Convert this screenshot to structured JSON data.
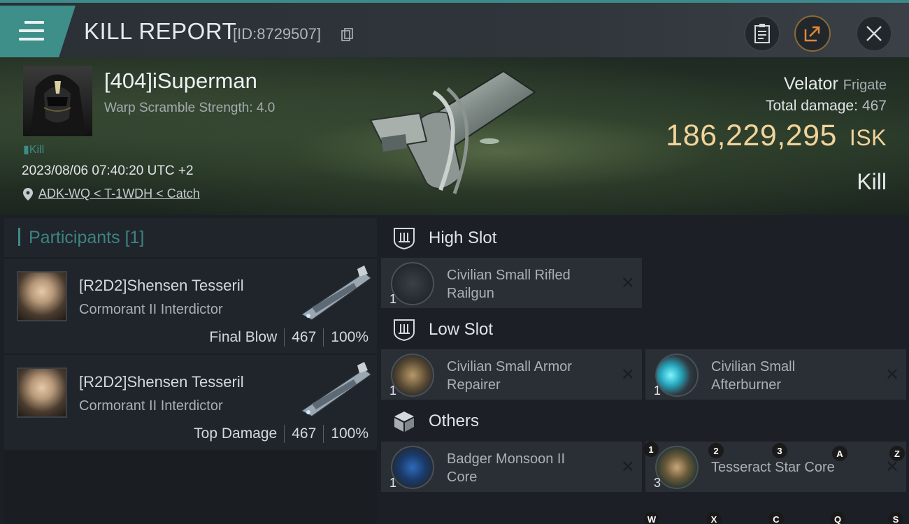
{
  "header": {
    "title": "KILL REPORT",
    "report_id": "[ID:8729507]"
  },
  "victim": {
    "name": "[404]iSuperman",
    "warp_scramble": "Warp Scramble Strength: 4.0",
    "tag": "Kill",
    "datetime": "2023/08/06 07:40:20 UTC +2",
    "location": "ADK-WQ < T-1WDH < Catch",
    "ship_name": "Velator",
    "ship_class": "Frigate",
    "total_damage_label": "Total damage:",
    "total_damage_value": "467",
    "isk_value": "186,229,295",
    "isk_unit": "ISK",
    "result": "Kill"
  },
  "participants": {
    "header": "Participants",
    "count": "[1]",
    "rows": [
      {
        "name": "[R2D2]Shensen Tesseril",
        "ship": "Cormorant II Interdictor",
        "role": "Final Blow",
        "damage": "467",
        "percent": "100%"
      },
      {
        "name": "[R2D2]Shensen Tesseril",
        "ship": "Cormorant II Interdictor",
        "role": "Top Damage",
        "damage": "467",
        "percent": "100%"
      }
    ]
  },
  "fitting": {
    "high_slot": "High Slot",
    "low_slot": "Low Slot",
    "others": "Others",
    "high_modules": [
      {
        "qty": "1",
        "name_line1": "Civilian Small Rifled",
        "name_line2": "Railgun"
      }
    ],
    "low_modules": [
      {
        "qty": "1",
        "name_line1": "Civilian Small Armor",
        "name_line2": "Repairer"
      },
      {
        "qty": "1",
        "name_line1": "Civilian Small",
        "name_line2": "Afterburner"
      }
    ],
    "other_modules": [
      {
        "qty": "1",
        "name_line1": "Badger Monsoon II",
        "name_line2": "Core"
      },
      {
        "qty": "3",
        "name_line1": "Tesseract Star Core",
        "name_line2": ""
      }
    ]
  },
  "key_hints": {
    "k1": "1",
    "k2": "2",
    "k3": "3",
    "kA": "A",
    "kZ": "Z",
    "kW": "W",
    "kX": "X",
    "kC": "C",
    "kQ": "Q",
    "kS": "S"
  }
}
